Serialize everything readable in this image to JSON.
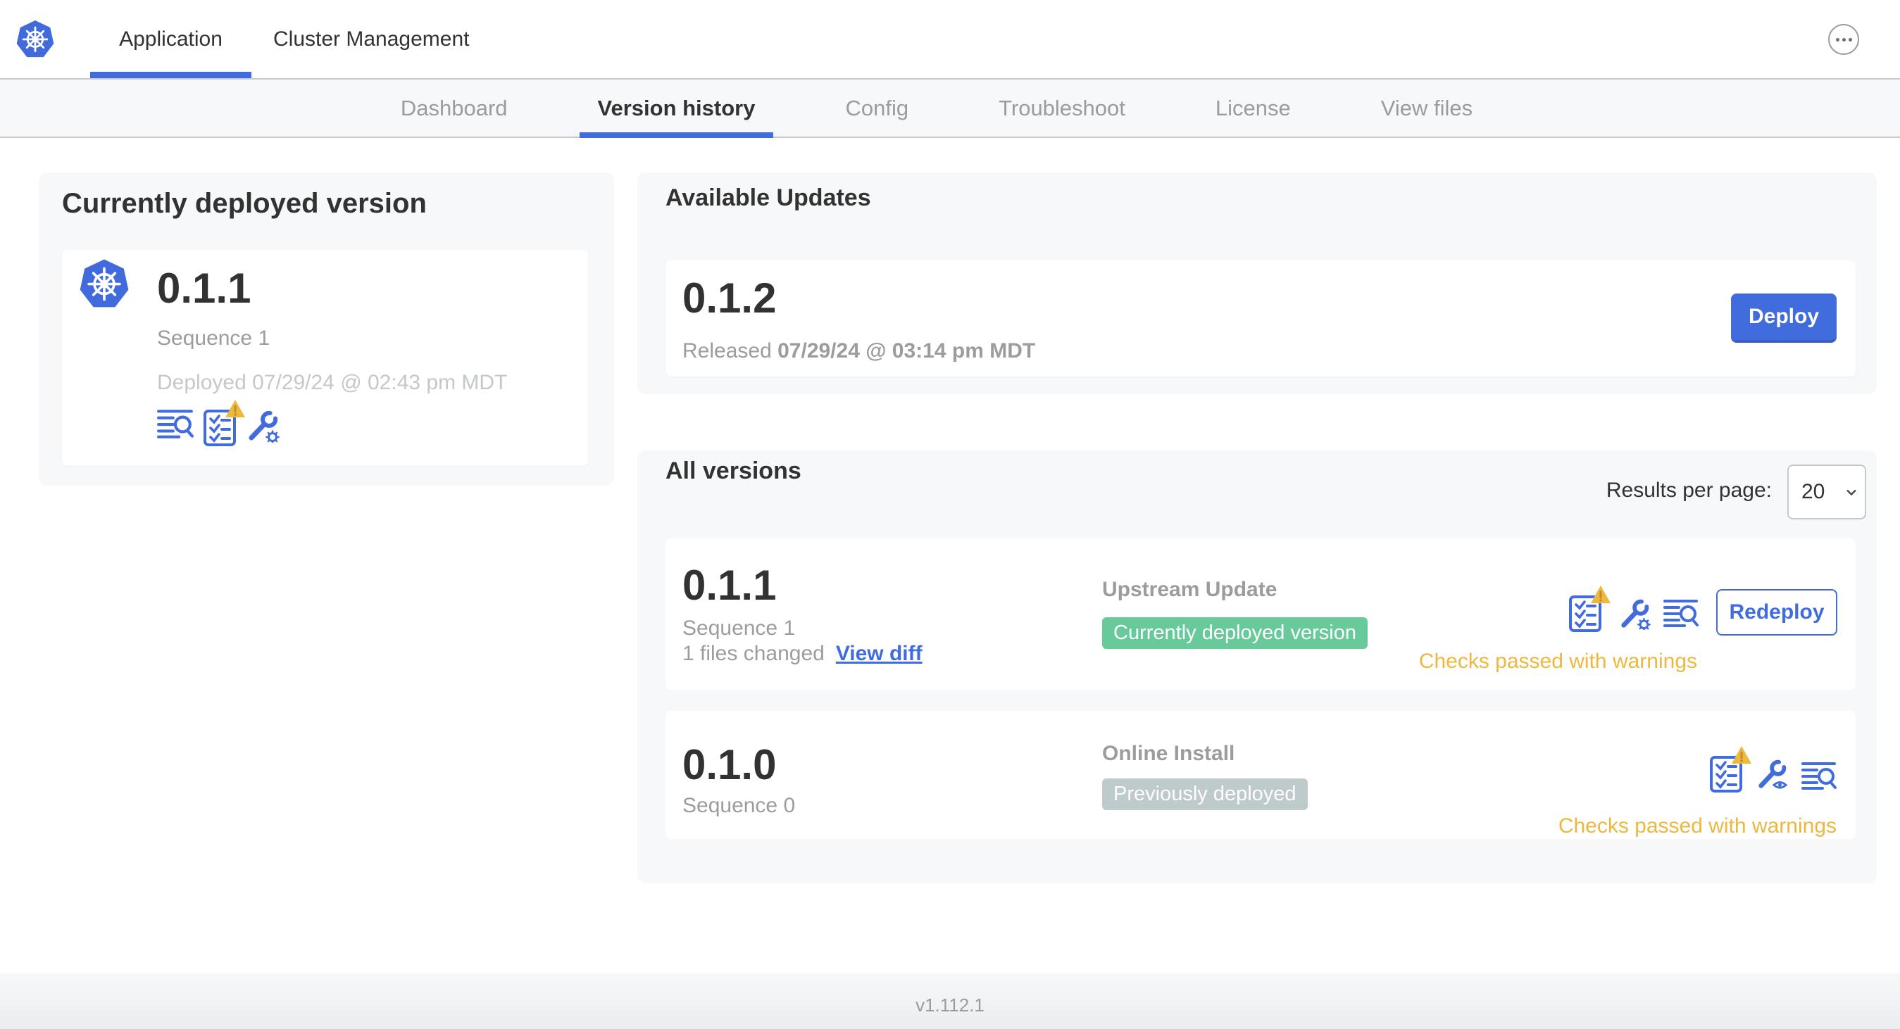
{
  "header": {
    "tabs": [
      {
        "label": "Application",
        "active": true
      },
      {
        "label": "Cluster Management",
        "active": false
      }
    ]
  },
  "nav": {
    "items": [
      {
        "label": "Dashboard",
        "active": false
      },
      {
        "label": "Version history",
        "active": true
      },
      {
        "label": "Config",
        "active": false
      },
      {
        "label": "Troubleshoot",
        "active": false
      },
      {
        "label": "License",
        "active": false
      },
      {
        "label": "View files",
        "active": false
      }
    ]
  },
  "current_version_card": {
    "title": "Currently deployed version",
    "version": "0.1.1",
    "sequence": "Sequence 1",
    "deployed": "Deployed 07/29/24 @ 02:43 pm MDT"
  },
  "available_updates": {
    "title": "Available Updates",
    "version": "0.1.2",
    "released_label": "Released",
    "released_date": "07/29/24 @ 03:14 pm MDT",
    "deploy_label": "Deploy"
  },
  "all_versions": {
    "title": "All versions",
    "results_per_page_label": "Results per page:",
    "results_per_page_value": "20",
    "rows": [
      {
        "version": "0.1.1",
        "sequence": "Sequence 1",
        "files_changed": "1 files changed",
        "view_diff_label": "View diff",
        "source": "Upstream Update",
        "badge": "Currently deployed version",
        "badge_style": "green",
        "action_label": "Redeploy",
        "status": "Checks passed with warnings"
      },
      {
        "version": "0.1.0",
        "sequence": "Sequence 0",
        "source": "Online Install",
        "badge": "Previously deployed",
        "badge_style": "gray",
        "status": "Checks passed with warnings"
      }
    ]
  },
  "footer": {
    "app_version": "v1.112.1"
  },
  "colors": {
    "accent": "#416cde",
    "warning": "#edb83f",
    "green_badge": "#68c99b",
    "gray_badge": "#bfcacc",
    "card_bg": "#f6f8f9",
    "border": "#c5c8ca"
  }
}
